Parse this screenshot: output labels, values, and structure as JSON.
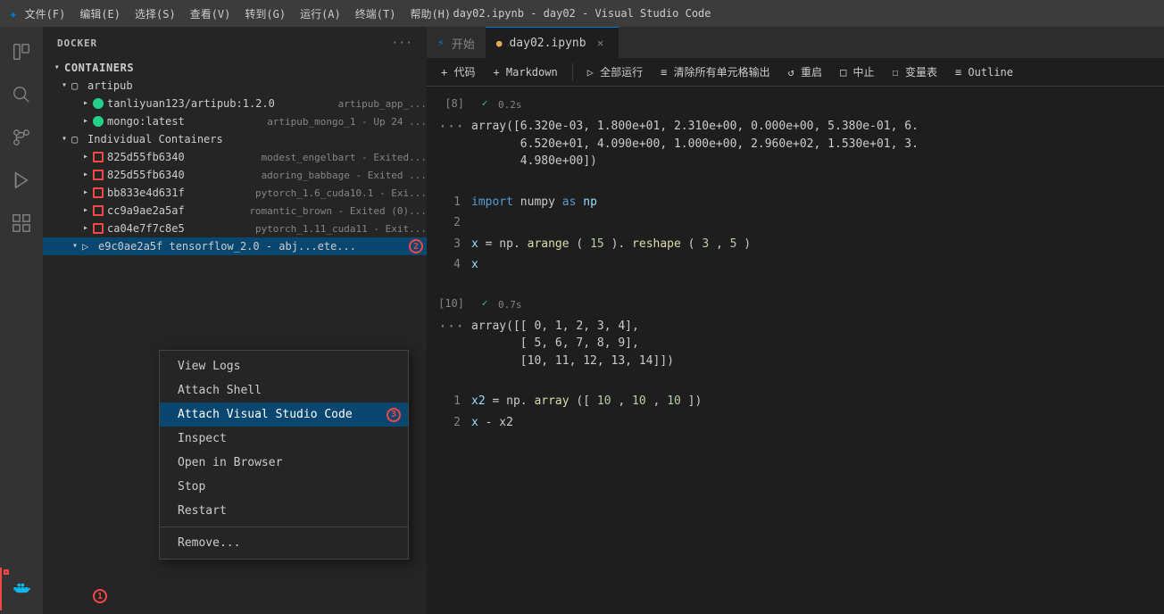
{
  "titleBar": {
    "title": "day02.ipynb - day02 - Visual Studio Code",
    "menus": [
      "文件(F)",
      "编辑(E)",
      "选择(S)",
      "查看(V)",
      "转到(G)",
      "运行(A)",
      "终端(T)",
      "帮助(H)"
    ]
  },
  "sidebar": {
    "header": "DOCKER",
    "moreLabel": "···",
    "containersSection": "CONTAINERS",
    "groups": [
      {
        "name": "artipub",
        "expanded": true,
        "children": [
          {
            "name": "tanliyuan123/artipub:1.2.0",
            "sub": "artipub_app_...",
            "status": "running"
          },
          {
            "name": "mongo:latest",
            "sub": "artipub_mongo_1 - Up 24 ...",
            "status": "running"
          }
        ]
      },
      {
        "name": "Individual Containers",
        "expanded": true,
        "children": [
          {
            "name": "825d55fb6340",
            "sub": "modest_engelbart - Exited...",
            "status": "stopped"
          },
          {
            "name": "825d55fb6340",
            "sub": "adoring_babbage - Exited ...",
            "status": "stopped"
          },
          {
            "name": "bb833e4d631f",
            "sub": "pytorch_1.6_cuda10.1 - Exi...",
            "status": "stopped"
          },
          {
            "name": "cc9a9ae2a5af",
            "sub": "romantic_brown - Exited (0)...",
            "status": "stopped"
          },
          {
            "name": "ca04e7f7c8e5",
            "sub": "pytorch_1.11_cuda11 - Exit...",
            "status": "stopped"
          },
          {
            "name": "e9c0ae2a5f",
            "sub": "tensorflow_2.0 - abj...ete...",
            "status": "running",
            "highlighted": true
          }
        ]
      }
    ]
  },
  "contextMenu": {
    "items": [
      {
        "label": "View Logs",
        "id": "view-logs"
      },
      {
        "label": "Attach Shell",
        "id": "attach-shell"
      },
      {
        "label": "Attach Visual Studio Code",
        "id": "attach-vscode",
        "active": true
      },
      {
        "label": "Inspect",
        "id": "inspect"
      },
      {
        "label": "Open in Browser",
        "id": "open-browser"
      },
      {
        "label": "Stop",
        "id": "stop"
      },
      {
        "label": "Restart",
        "id": "restart"
      },
      {
        "separator": true
      },
      {
        "label": "Remove...",
        "id": "remove"
      }
    ]
  },
  "tabs": {
    "welcome": {
      "label": "开始",
      "icon": "⚡"
    },
    "notebook": {
      "label": "day02.ipynb",
      "active": true
    }
  },
  "toolbar": {
    "addCode": "+ 代码",
    "addMarkdown": "+ Markdown",
    "runAll": "▷  全部运行",
    "clearOutput": "≡  清除所有单元格输出",
    "restart": "↺  重启",
    "stop": "□  中止",
    "variables": "☐  变量表",
    "outline": "≡  Outline"
  },
  "notebook": {
    "outputs": [
      {
        "cellNum": "[8]",
        "checkmark": "✓",
        "time": "0.2s",
        "outputLines": [
          "array([6.320e-03, 1.800e+01, 2.310e+00, 0.000e+00, 5.380e-01, 6.",
          "       6.520e+01, 4.090e+00, 1.000e+00, 2.960e+02, 1.530e+01, 3.",
          "       4.980e+00])"
        ]
      }
    ],
    "cells": [
      {
        "lines": [
          {
            "num": 1,
            "code": "import numpy as np",
            "tokens": [
              {
                "text": "import",
                "cls": "kw"
              },
              {
                "text": " numpy ",
                "cls": "op"
              },
              {
                "text": "as",
                "cls": "kw"
              },
              {
                "text": " np",
                "cls": "var-color"
              }
            ]
          },
          {
            "num": 2,
            "code": "",
            "tokens": []
          },
          {
            "num": 3,
            "code": "x = np.arange(15).reshape(3, 5)",
            "tokens": [
              {
                "text": "x",
                "cls": "var-color"
              },
              {
                "text": " = np.",
                "cls": "op"
              },
              {
                "text": "arange",
                "cls": "fn"
              },
              {
                "text": "(",
                "cls": "op"
              },
              {
                "text": "15",
                "cls": "num"
              },
              {
                "text": ").",
                "cls": "op"
              },
              {
                "text": "reshape",
                "cls": "fn"
              },
              {
                "text": "(",
                "cls": "op"
              },
              {
                "text": "3",
                "cls": "num"
              },
              {
                "text": ", ",
                "cls": "op"
              },
              {
                "text": "5",
                "cls": "num"
              },
              {
                "text": ")",
                "cls": "op"
              }
            ]
          },
          {
            "num": 4,
            "code": "x",
            "tokens": [
              {
                "text": "x",
                "cls": "var-color"
              }
            ]
          }
        ]
      }
    ],
    "output2": {
      "cellNum": "[10]",
      "checkmark": "✓",
      "time": "0.7s",
      "outputLines": [
        "array([[ 0,  1,  2,  3,  4],",
        "       [ 5,  6,  7,  8,  9],",
        "       [10, 11, 12, 13, 14]])"
      ]
    },
    "cell2": {
      "lines": [
        {
          "num": 1,
          "tokens": [
            {
              "text": "x2",
              "cls": "var-color"
            },
            {
              "text": " = np.",
              "cls": "op"
            },
            {
              "text": "array",
              "cls": "fn"
            },
            {
              "text": "([",
              "cls": "op"
            },
            {
              "text": "10",
              "cls": "num"
            },
            {
              "text": ", ",
              "cls": "op"
            },
            {
              "text": "10",
              "cls": "num"
            },
            {
              "text": ", ",
              "cls": "op"
            },
            {
              "text": "10",
              "cls": "num"
            },
            {
              "text": "])",
              "cls": "op"
            }
          ]
        },
        {
          "num": 2,
          "tokens": [
            {
              "text": "x",
              "cls": "var-color"
            },
            {
              "text": " - x2",
              "cls": "op"
            }
          ]
        }
      ]
    }
  },
  "annotations": {
    "dockerIcon": "1",
    "containerItem": "2",
    "attachVscode": "3"
  },
  "icons": {
    "vscode": "VS",
    "explorer": "⎘",
    "search": "🔍",
    "sourceControl": "⑂",
    "run": "▷",
    "extensions": "⊞",
    "docker": "🐳",
    "gear": "⚙"
  }
}
